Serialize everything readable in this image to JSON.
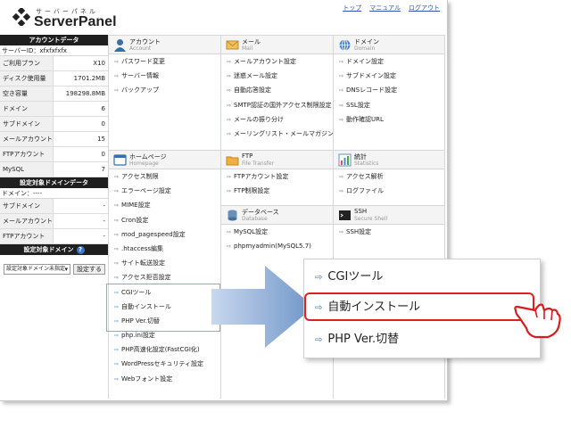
{
  "header": {
    "logo_kana": "サーバーパネル",
    "logo_name": "ServerPanel",
    "links": [
      "トップ",
      "マニュアル",
      "ログアウト"
    ]
  },
  "sidebar": {
    "account_title": "アカウントデータ",
    "server_id": "サーバーID：xfxfxfxfx",
    "rows": [
      {
        "label": "ご利用プラン",
        "value": "X10"
      },
      {
        "label": "ディスク使用量",
        "value": "1701.2MB"
      },
      {
        "label": "空き容量",
        "value": "198298.8MB"
      },
      {
        "label": "ドメイン",
        "value": "6"
      },
      {
        "label": "サブドメイン",
        "value": "0"
      },
      {
        "label": "メールアカウント",
        "value": "15"
      },
      {
        "label": "FTPアカウント",
        "value": "0"
      },
      {
        "label": "MySQL",
        "value": "7"
      }
    ],
    "target_title": "設定対象ドメインデータ",
    "domain_line": "ドメイン：----",
    "target_rows": [
      {
        "label": "サブドメイン",
        "value": "-"
      },
      {
        "label": "メールアカウント",
        "value": "-"
      },
      {
        "label": "FTPアカウント",
        "value": "-"
      }
    ],
    "set_domain_title": "設定対象ドメイン",
    "help_label": "?",
    "select_value": "設定対象ドメイン未指定",
    "set_button": "設定する"
  },
  "categories": {
    "account": {
      "ja": "アカウント",
      "en": "Account",
      "items": [
        "パスワード変更",
        "サーバー情報",
        "バックアップ"
      ]
    },
    "mail": {
      "ja": "メール",
      "en": "Mail",
      "items": [
        "メールアカウント設定",
        "迷惑メール設定",
        "自動応答設定",
        "SMTP認証の国外アクセス制限設定",
        "メールの振り分け",
        "メーリングリスト・メールマガジン"
      ]
    },
    "domain": {
      "ja": "ドメイン",
      "en": "Domain",
      "items": [
        "ドメイン設定",
        "サブドメイン設定",
        "DNSレコード設定",
        "SSL設定",
        "動作確認URL"
      ]
    },
    "homepage": {
      "ja": "ホームページ",
      "en": "Homepage",
      "items": [
        "アクセス制限",
        "エラーページ設定",
        "MIME設定",
        "Cron設定",
        "mod_pagespeed設定",
        ".htaccess編集",
        "サイト転送設定",
        "アクセス拒否設定",
        "CGIツール",
        "自動インストール",
        "PHP Ver.切替",
        "php.ini設定",
        "PHP高速化設定(FastCGI化)",
        "WordPressセキュリティ設定",
        "Webフォント設定"
      ]
    },
    "ftp": {
      "ja": "FTP",
      "en": "File Transfer",
      "items": [
        "FTPアカウント設定",
        "FTP制限設定"
      ]
    },
    "stats": {
      "ja": "統計",
      "en": "Statistics",
      "items": [
        "アクセス解析",
        "ログファイル"
      ]
    },
    "database": {
      "ja": "データベース",
      "en": "Database",
      "items": [
        "MySQL設定",
        "phpmyadmin(MySQL5.7)"
      ]
    },
    "ssh": {
      "ja": "SSH",
      "en": "Secure Shell",
      "items": [
        "SSH設定"
      ]
    }
  },
  "zoom": {
    "items": [
      "CGIツール",
      "自動インストール",
      "PHP Ver.切替"
    ],
    "highlight_color": "#e02020"
  },
  "colors": {
    "accent": "#3b6fb0",
    "sidebar_header": "#1f1f1f"
  }
}
